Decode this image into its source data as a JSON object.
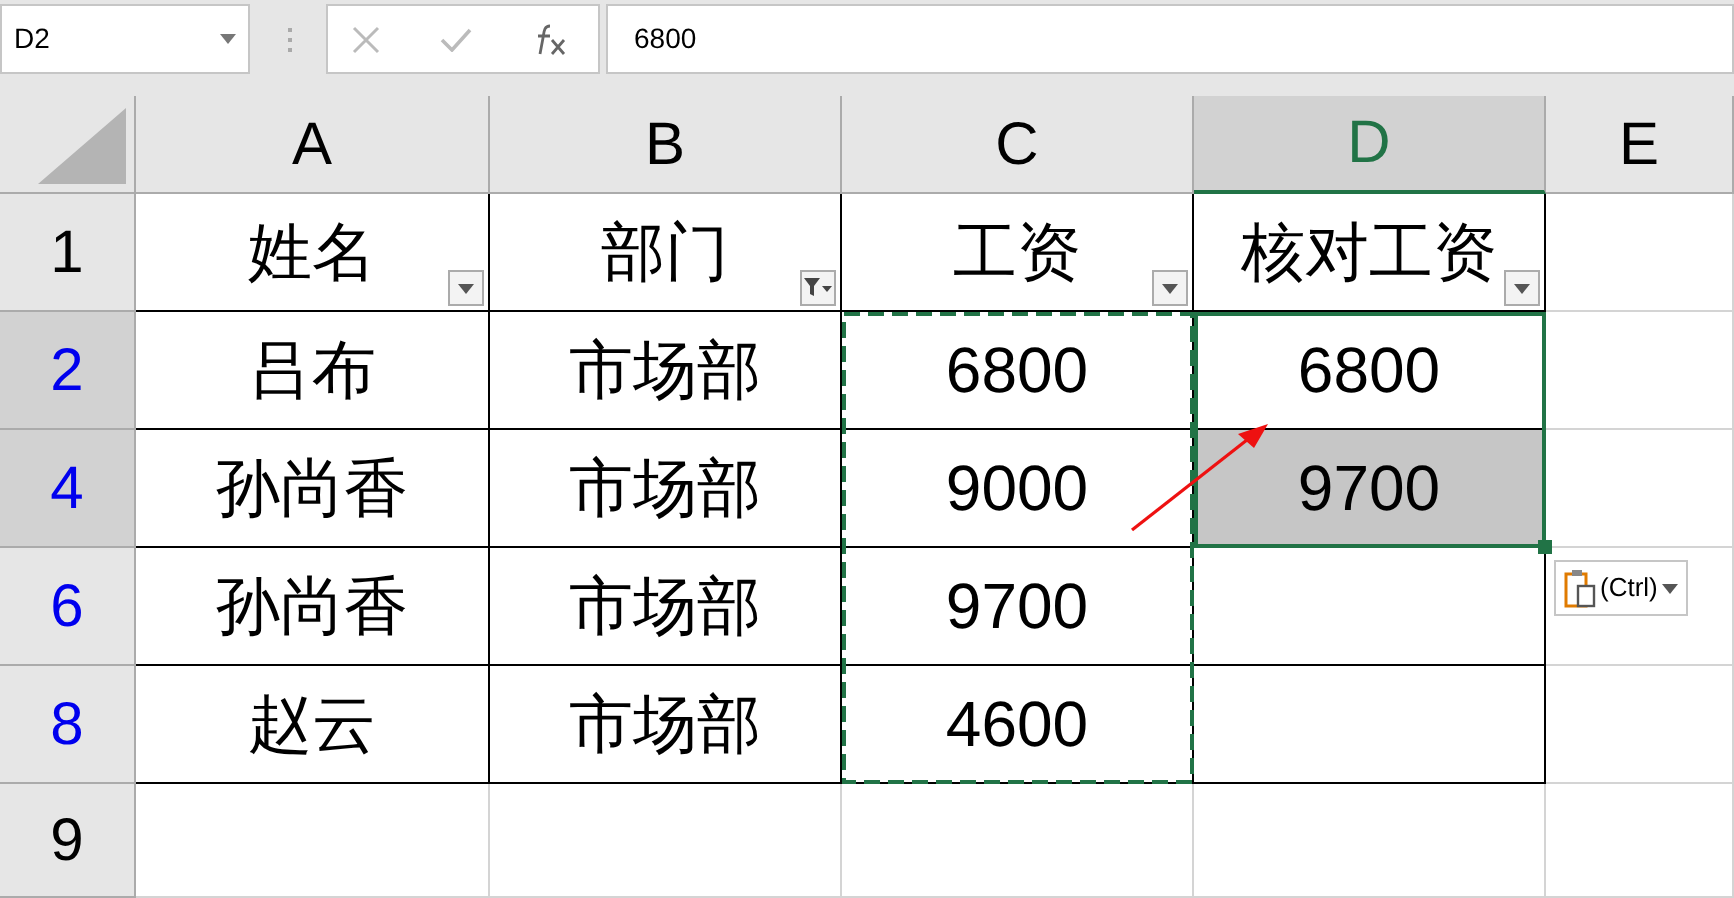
{
  "name_box": {
    "value": "D2"
  },
  "formula_bar": {
    "value": "6800"
  },
  "columns": [
    {
      "label": "A",
      "selected": false
    },
    {
      "label": "B",
      "selected": false
    },
    {
      "label": "C",
      "selected": false
    },
    {
      "label": "D",
      "selected": true
    },
    {
      "label": "E",
      "selected": false
    }
  ],
  "rows": [
    {
      "number": "1",
      "selected": false,
      "filtered": false,
      "cells": [
        {
          "text": "姓名",
          "kind": "dropdown",
          "shaded": false
        },
        {
          "text": "部门",
          "kind": "filtered",
          "shaded": false
        },
        {
          "text": "工资",
          "kind": "dropdown",
          "shaded": false
        },
        {
          "text": "核对工资",
          "kind": "dropdown",
          "shaded": false
        }
      ]
    },
    {
      "number": "2",
      "selected": true,
      "filtered": true,
      "cells": [
        {
          "text": "吕布",
          "shaded": false
        },
        {
          "text": "市场部",
          "shaded": false
        },
        {
          "text": "6800",
          "shaded": false
        },
        {
          "text": "6800",
          "shaded": false
        }
      ]
    },
    {
      "number": "4",
      "selected": true,
      "filtered": true,
      "cells": [
        {
          "text": "孙尚香",
          "shaded": false
        },
        {
          "text": "市场部",
          "shaded": false
        },
        {
          "text": "9000",
          "shaded": false
        },
        {
          "text": "9700",
          "shaded": true
        }
      ]
    },
    {
      "number": "6",
      "selected": false,
      "filtered": true,
      "cells": [
        {
          "text": "孙尚香",
          "shaded": false
        },
        {
          "text": "市场部",
          "shaded": false
        },
        {
          "text": "9700",
          "shaded": false
        },
        {
          "text": "",
          "shaded": false
        }
      ]
    },
    {
      "number": "8",
      "selected": false,
      "filtered": true,
      "cells": [
        {
          "text": "赵云",
          "shaded": false
        },
        {
          "text": "市场部",
          "shaded": false
        },
        {
          "text": "4600",
          "shaded": false
        },
        {
          "text": "",
          "shaded": false
        }
      ]
    },
    {
      "number": "9",
      "selected": false,
      "filtered": false,
      "cells": []
    }
  ],
  "paste_options": {
    "label": "(Ctrl)"
  }
}
